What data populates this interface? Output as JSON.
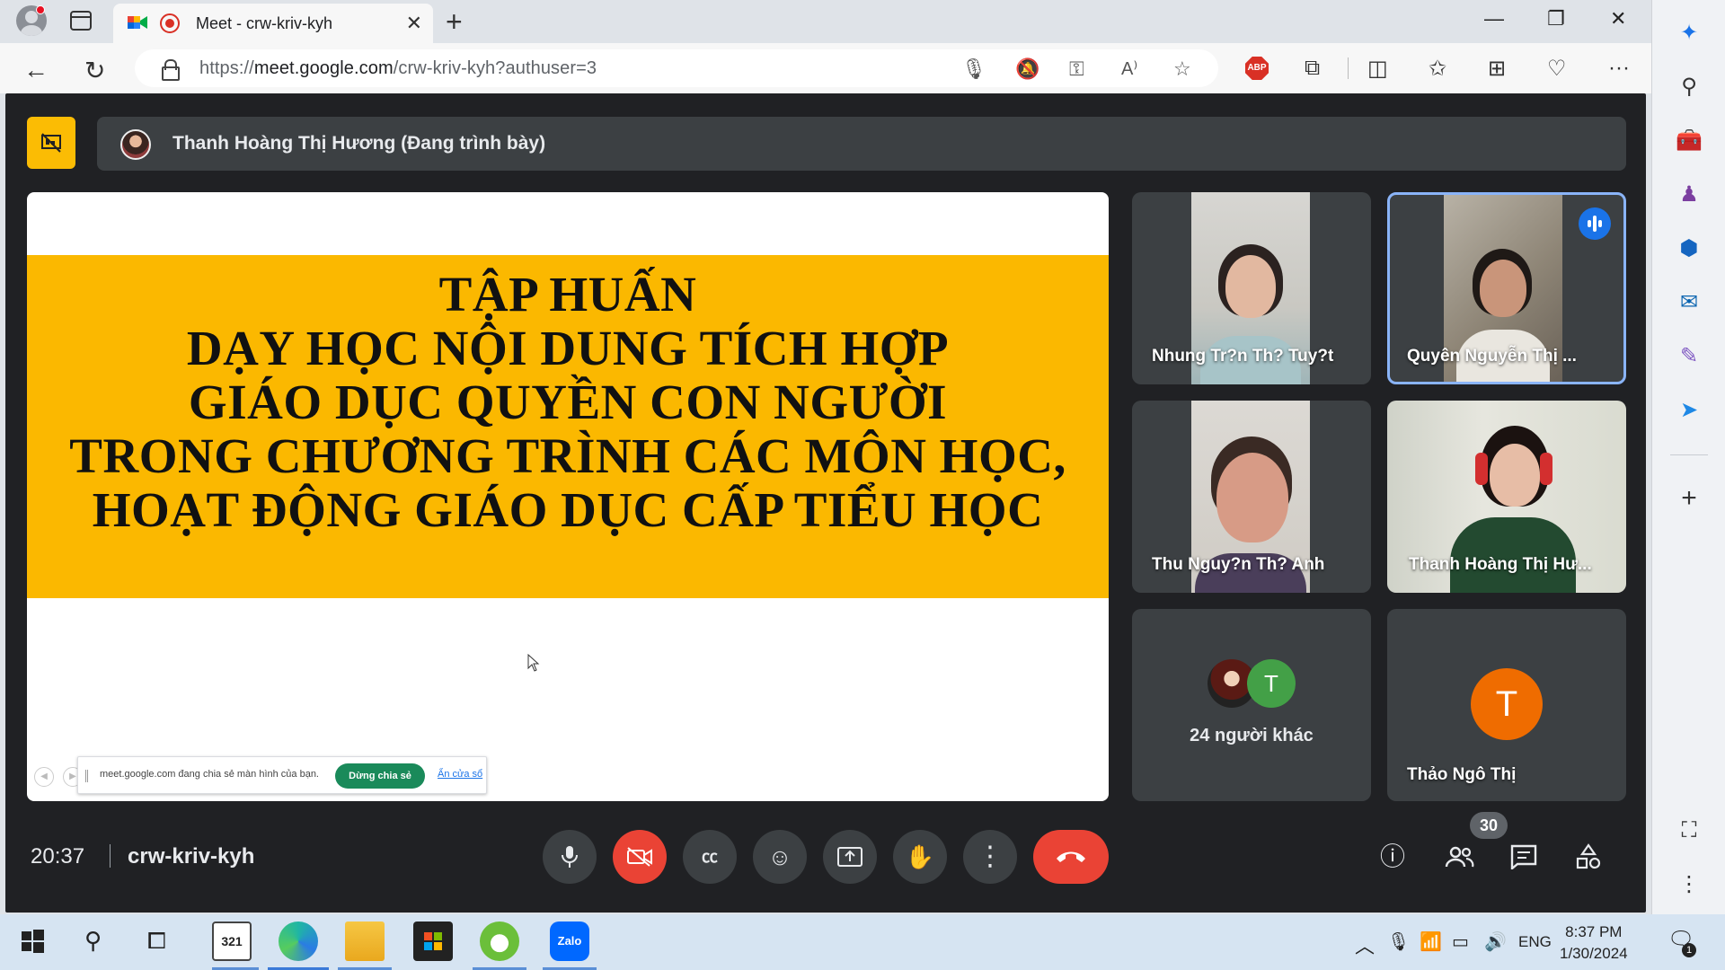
{
  "browser": {
    "tab_title": "Meet - crw-kriv-kyh",
    "url_prefix": "https://",
    "url_host": "meet.google.com",
    "url_path": "/crw-kriv-kyh?authuser=3",
    "abp_label": "ABP"
  },
  "meet": {
    "presenter_label": "Thanh Hoàng Thị Hương (Đang trình bày)",
    "slide_lines": [
      "TẬP HUẤN",
      "DẠY HỌC NỘI DUNG TÍCH HỢP",
      "GIÁO DỤC QUYỀN CON NGƯỜI",
      "TRONG CHƯƠNG TRÌNH CÁC MÔN HỌC,",
      "HOẠT ĐỘNG GIÁO DỤC CẤP TIỂU HỌC"
    ],
    "share_banner": {
      "text": "meet.google.com đang chia sẻ màn hình của bạn.",
      "stop_label": "Dừng chia sẻ",
      "hide_label": "Ẩn cửa sổ"
    },
    "participants": [
      {
        "name": "Nhung Tr?n Th? Tuy?t"
      },
      {
        "name": "Quyên Nguyễn Thị ..."
      },
      {
        "name": "Thu Nguy?n Th? Anh"
      },
      {
        "name": "Thanh Hoàng Thị Hư..."
      }
    ],
    "others": {
      "initial": "T",
      "label": "24 người khác"
    },
    "thao": {
      "initial": "T",
      "name": "Thảo Ngô Thị"
    },
    "time": "20:37",
    "meeting_code": "crw-kriv-kyh",
    "people_count": "30"
  },
  "taskbar": {
    "lang": "ENG",
    "time": "8:37 PM",
    "date": "1/30/2024",
    "notif_count": "1",
    "calendar_day": "321",
    "zalo_label": "Zalo"
  },
  "colors": {
    "meet_bg": "#202124",
    "tile_bg": "#3c4043",
    "slide_band": "#fbb800",
    "end_call": "#ea4335",
    "avatar_orange": "#ef6c00",
    "avatar_green": "#43a047",
    "speaking_blue": "#1a73e8"
  }
}
